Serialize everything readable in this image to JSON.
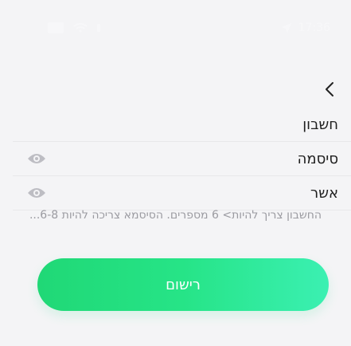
{
  "status_bar": {
    "time": "17:36",
    "icons": [
      "battery-icon",
      "wifi-icon",
      "signal-icon",
      "location-icon"
    ]
  },
  "nav": {
    "back_icon": "chevron-left-icon"
  },
  "form": {
    "fields": [
      {
        "label": "חשבון",
        "has_eye": false
      },
      {
        "label": "סיסמה",
        "has_eye": true
      },
      {
        "label": "אשר",
        "has_eye": true
      }
    ]
  },
  "helper_text": "החשבון צריך להיות> 6 מספרים. הסיסמא צריכה להיות 6-8...",
  "register_button": {
    "label": "רישום"
  },
  "colors": {
    "background": "#f4f4f6",
    "button_start": "#20d876",
    "button_end": "#3bf0b2",
    "eye": "#bdbdc3",
    "helper_text": "#9b9ba1"
  }
}
